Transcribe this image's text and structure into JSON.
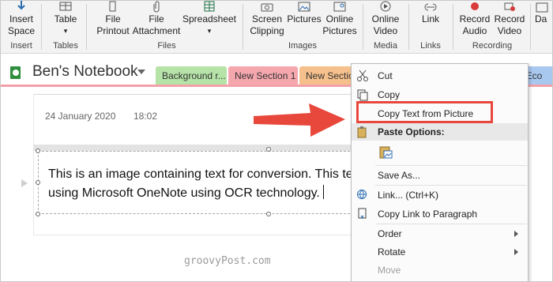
{
  "ribbon": {
    "insert_space": "Insert\nSpace",
    "table": "Table",
    "file_printout": "File\nPrintout",
    "file_attachment": "File\nAttachment",
    "spreadsheet": "Spreadsheet",
    "screen_clipping": "Screen\nClipping",
    "pictures": "Pictures",
    "online_pictures": "Online\nPictures",
    "online_video": "Online\nVideo",
    "link": "Link",
    "record_audio": "Record\nAudio",
    "record_video": "Record\nVideo",
    "da": "Da",
    "groups": {
      "insert": "Insert",
      "tables": "Tables",
      "files": "Files",
      "images": "Images",
      "media": "Media",
      "links": "Links",
      "recording": "Recording"
    }
  },
  "notebook": {
    "name": "Ben's Notebook",
    "tabs": [
      {
        "label": "Background r...",
        "color": "#b6e3a8"
      },
      {
        "label": "New Section 1",
        "color": "#f5a7ae"
      },
      {
        "label": "New Sectio",
        "color": "#f6c08c"
      },
      {
        "label": "S - Eco",
        "color": "#a9c8ef"
      }
    ]
  },
  "page": {
    "date": "24 January 2020",
    "time": "18:02",
    "line1": "This is an image containing text for conversion. This te",
    "line2": "using Microsoft OneNote using OCR technology."
  },
  "menu": {
    "cut": "Cut",
    "copy": "Copy",
    "copy_text_from_picture": "Copy Text from Picture",
    "paste_options": "Paste Options:",
    "save_as": "Save As...",
    "link": "Link...  (Ctrl+K)",
    "copy_link_to_paragraph": "Copy Link to Paragraph",
    "order": "Order",
    "rotate": "Rotate",
    "move": "Move"
  },
  "watermark": "groovyPost.com",
  "colors": {
    "highlight_box": "#e8473c",
    "arrow": "#e8473c",
    "section_line": "#f4a0a8"
  }
}
